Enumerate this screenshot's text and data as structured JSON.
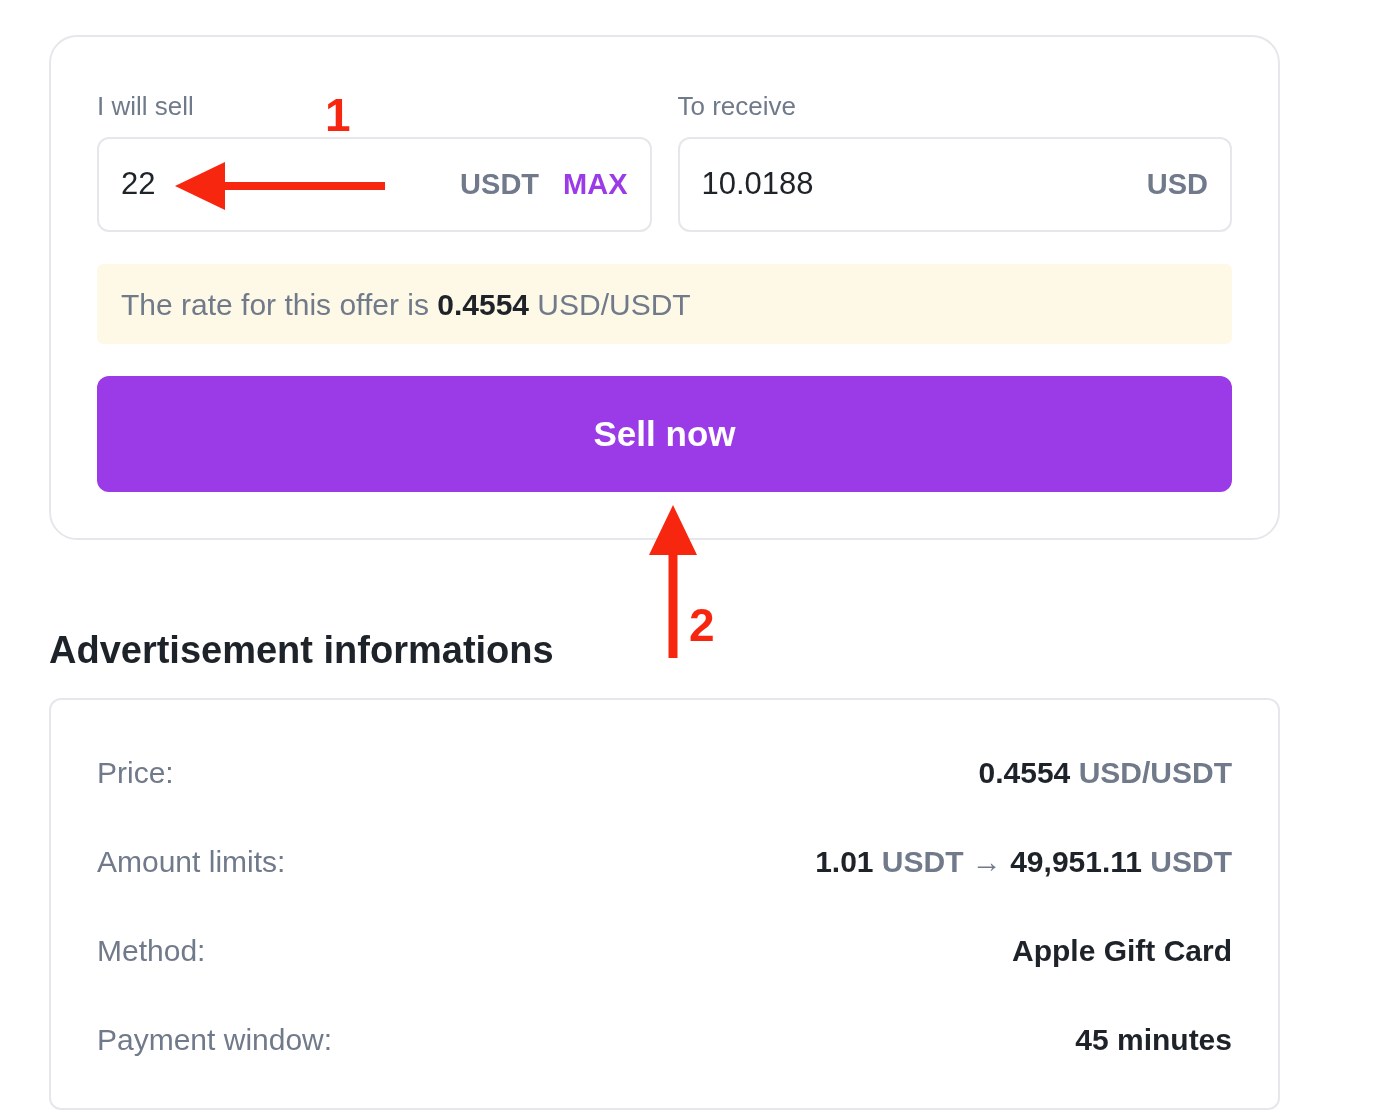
{
  "trade_form": {
    "sell_field": {
      "label": "I will sell",
      "value": "22",
      "unit": "USDT",
      "max_link": "MAX"
    },
    "receive_field": {
      "label": "To receive",
      "value": "10.0188",
      "unit": "USD"
    },
    "rate_notice": "The rate for this offer is **0.4554** USD/USDT",
    "submit_button": "Sell now"
  },
  "annotations": [
    {
      "kind": "left",
      "label": "1"
    },
    {
      "kind": "up",
      "label": "2"
    }
  ],
  "advertisement": {
    "heading": "Advertisement informations",
    "rows": [
      {
        "label": "Price:",
        "value": "**0.4554** USD/USDT",
        "kind": "mixed"
      },
      {
        "label": "Amount limits:",
        "value": "**1.01** USDT → **49,951.11** USDT",
        "kind": "mixed"
      },
      {
        "label": "Method:",
        "value": "Apple Gift Card",
        "kind": "strong"
      },
      {
        "label": "Payment window:",
        "value": "45 minutes",
        "kind": "strong"
      }
    ]
  }
}
